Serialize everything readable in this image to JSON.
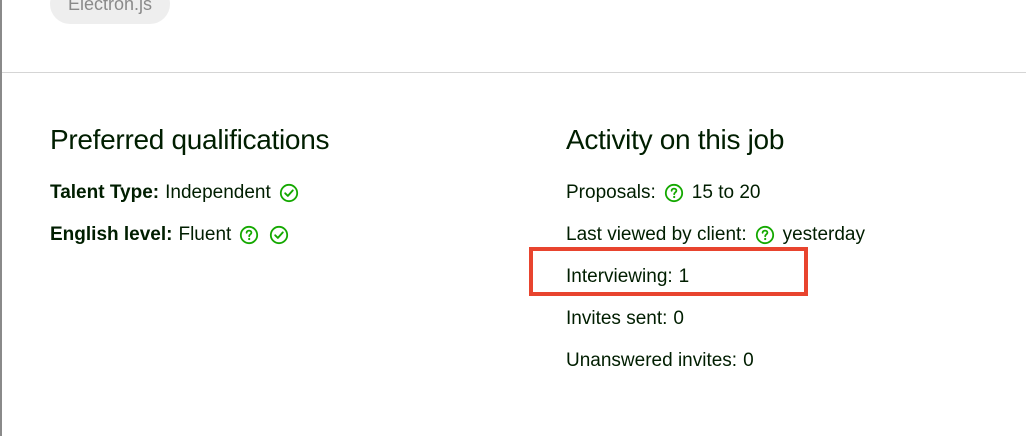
{
  "skill_chip": {
    "label": "Electron.js"
  },
  "preferred_qualifications": {
    "title": "Preferred qualifications",
    "rows": [
      {
        "label": "Talent Type:",
        "value": "Independent"
      },
      {
        "label": "English level:",
        "value": "Fluent"
      }
    ]
  },
  "activity": {
    "title": "Activity on this job",
    "rows": [
      {
        "label": "Proposals:",
        "value": "15 to 20"
      },
      {
        "label": "Last viewed by client:",
        "value": "yesterday"
      },
      {
        "label": "Interviewing:",
        "value": "1"
      },
      {
        "label": "Invites sent:",
        "value": "0"
      },
      {
        "label": "Unanswered invites:",
        "value": "0"
      }
    ]
  },
  "colors": {
    "icon_green": "#14a800",
    "highlight": "#e8442e",
    "text": "#001e00"
  },
  "icons": {
    "check": "check-circle-icon",
    "help": "help-circle-icon"
  }
}
